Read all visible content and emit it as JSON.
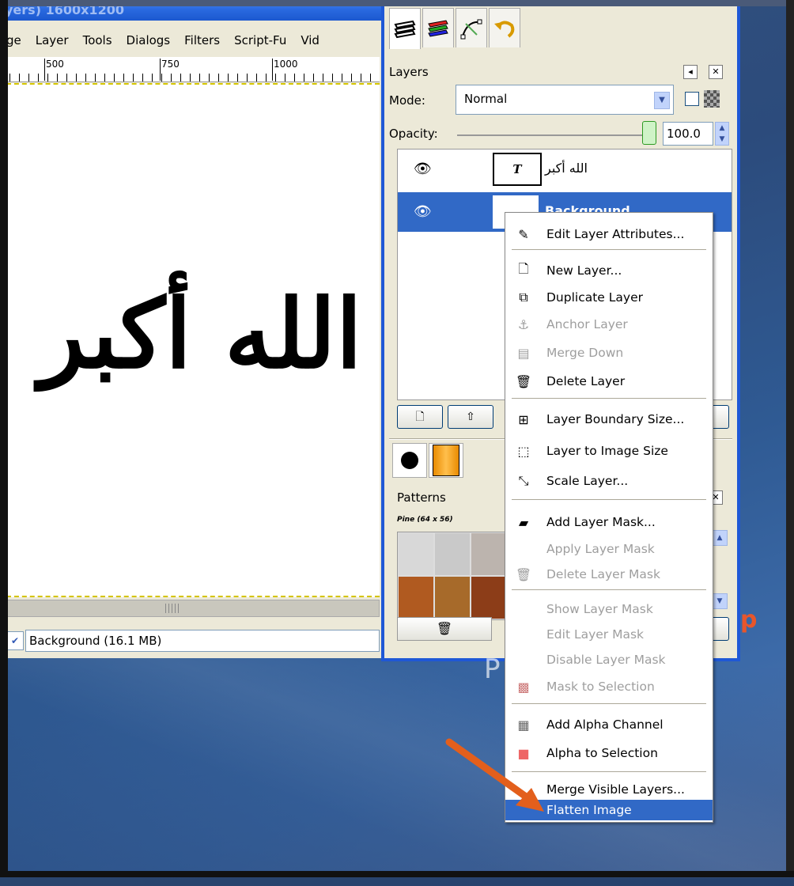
{
  "image_window": {
    "title": "yers) 1600x1200",
    "menu": [
      "ge",
      "Layer",
      "Tools",
      "Dialogs",
      "Filters",
      "Script-Fu",
      "Vid"
    ],
    "ruler": [
      "500",
      "750",
      "1000"
    ],
    "canvas_text": "الله أكبر",
    "status_text": "Background (16.1 MB)",
    "status_nav": "✔"
  },
  "dock": {
    "tab_icons": [
      "layers-icon",
      "channels-icon",
      "paths-icon",
      "undo-history-icon"
    ],
    "panel_title": "Layers",
    "mode_label": "Mode:",
    "mode_value": "Normal",
    "opacity_label": "Opacity:",
    "opacity_value": "100.0",
    "opacity_percent": 100,
    "layers": [
      {
        "name": "الله أكبر",
        "thumb": "T",
        "selected": false
      },
      {
        "name": "Background",
        "thumb": "",
        "selected": true
      }
    ],
    "patterns_label": "Patterns",
    "pattern_name": "Pine (64 x 56)"
  },
  "context_menu": {
    "items": [
      {
        "label": "Edit Layer Attributes...",
        "icon": "edit-attributes-icon",
        "glyph": "✎",
        "disabled": false
      },
      {
        "label": "New Layer...",
        "icon": "new-layer-icon",
        "glyph": "🗋",
        "disabled": false
      },
      {
        "label": "Duplicate Layer",
        "icon": "duplicate-layer-icon",
        "glyph": "⧉",
        "disabled": false
      },
      {
        "label": "Anchor Layer",
        "icon": "anchor-icon",
        "glyph": "⚓",
        "disabled": true
      },
      {
        "label": "Merge Down",
        "icon": "merge-down-icon",
        "glyph": "▤",
        "disabled": true
      },
      {
        "label": "Delete Layer",
        "icon": "trash-icon",
        "glyph": "🗑",
        "disabled": false
      },
      {
        "label": "Layer Boundary Size...",
        "icon": "boundary-size-icon",
        "glyph": "⊞",
        "disabled": false
      },
      {
        "label": "Layer to Image Size",
        "icon": "to-image-size-icon",
        "glyph": "⬚",
        "disabled": false
      },
      {
        "label": "Scale Layer...",
        "icon": "scale-layer-icon",
        "glyph": "⤡",
        "disabled": false
      },
      {
        "label": "Add Layer Mask...",
        "icon": "add-mask-icon",
        "glyph": "▰",
        "disabled": false
      },
      {
        "label": "Apply Layer Mask",
        "icon": "",
        "glyph": "",
        "disabled": true
      },
      {
        "label": "Delete Layer Mask",
        "icon": "trash-icon",
        "glyph": "🗑",
        "disabled": true
      },
      {
        "label": "Show Layer Mask",
        "icon": "",
        "glyph": "",
        "disabled": true
      },
      {
        "label": "Edit Layer Mask",
        "icon": "",
        "glyph": "",
        "disabled": true
      },
      {
        "label": "Disable Layer Mask",
        "icon": "",
        "glyph": "",
        "disabled": true
      },
      {
        "label": "Mask to Selection",
        "icon": "mask-to-selection-icon",
        "glyph": "▩",
        "disabled": true
      },
      {
        "label": "Add Alpha Channel",
        "icon": "alpha-channel-icon",
        "glyph": "▦",
        "disabled": false
      },
      {
        "label": "Alpha to Selection",
        "icon": "alpha-to-selection-icon",
        "glyph": "■",
        "disabled": false
      },
      {
        "label": "Merge Visible Layers...",
        "icon": "",
        "glyph": "",
        "disabled": false
      },
      {
        "label": "Flatten Image",
        "icon": "",
        "glyph": "",
        "disabled": false,
        "highlighted": true
      }
    ]
  },
  "watermark": {
    "left": "P",
    "right": "p"
  },
  "colors": {
    "selection": "#3169c6",
    "xp_blue": "#1f58d6",
    "arrow": "#e35f1c",
    "disabled_text": "#9e9e9e"
  }
}
